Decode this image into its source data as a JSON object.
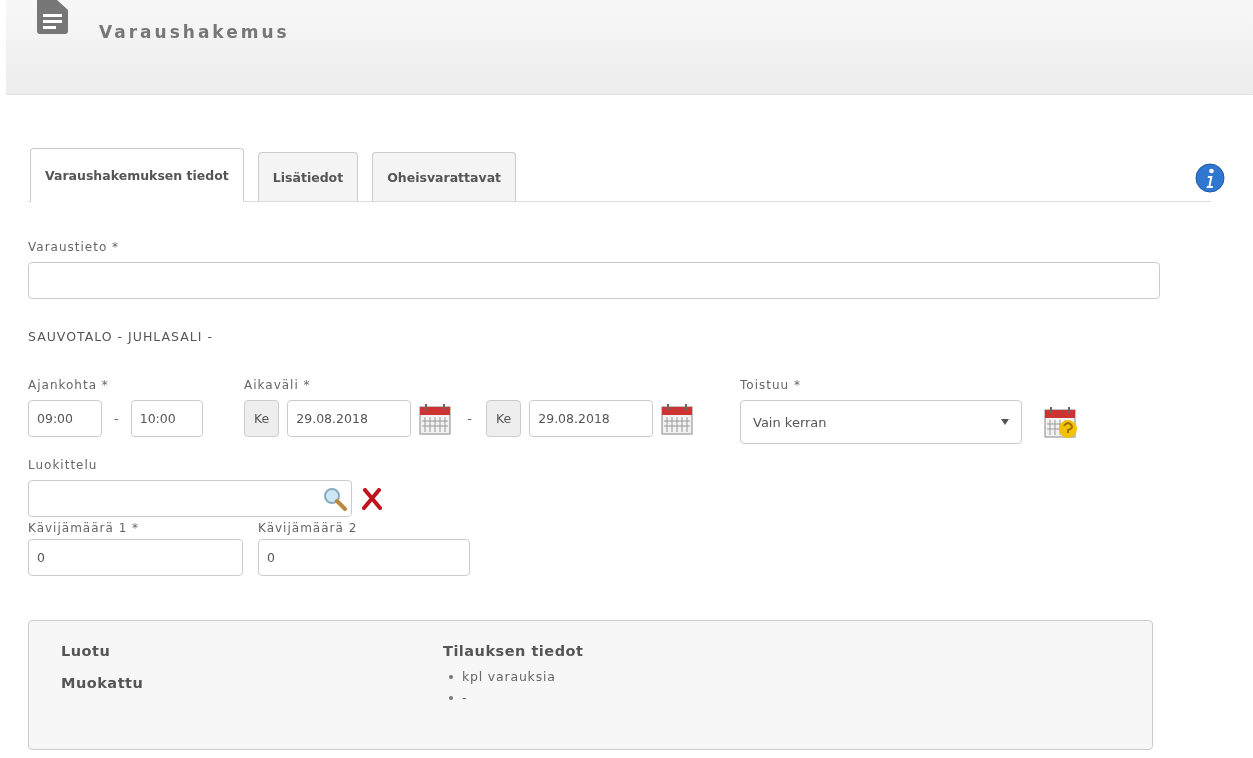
{
  "header": {
    "title": "Varaushakemus"
  },
  "tabs": [
    {
      "label": "Varaushakemuksen tiedot",
      "selected": true
    },
    {
      "label": "Lisätiedot",
      "selected": false
    },
    {
      "label": "Oheisvarattavat",
      "selected": false
    }
  ],
  "reservation": {
    "label": "Varaustieto *"
  },
  "location": "SAUVOTALO - JUHLASALI -",
  "time": {
    "label": "Ajankohta *",
    "start": "09:00",
    "separator": "-",
    "end": "10:00"
  },
  "period": {
    "label": "Aikaväli *",
    "start_day": "Ke",
    "start_date": "29.08.2018",
    "separator": "-",
    "end_day": "Ke",
    "end_date": "29.08.2018"
  },
  "repeat": {
    "label": "Toistuu *",
    "value": "Vain kerran"
  },
  "classification": {
    "label": "Luokittelu"
  },
  "visitors": [
    {
      "label": "Kävijämäärä 1 *",
      "value": "0"
    },
    {
      "label": "Kävijämäärä 2",
      "value": "0"
    }
  ],
  "summary": {
    "left": [
      "Luotu",
      "Muokattu"
    ],
    "right_title": "Tilauksen tiedot",
    "items": [
      "kpl varauksia",
      "-"
    ]
  }
}
